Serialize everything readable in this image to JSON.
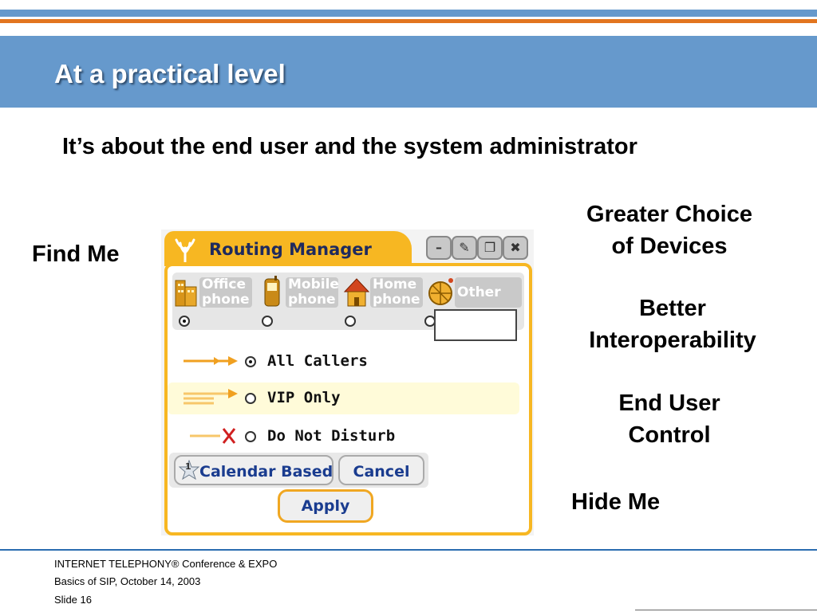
{
  "slide": {
    "title": "At a practical level",
    "subtitle": "It’s about the end user and the system administrator",
    "find_me": "Find Me",
    "hide_me": "Hide Me",
    "benefits": [
      {
        "line1": "Greater Choice",
        "line2": "of Devices"
      },
      {
        "line1": "Better",
        "line2": "Interoperability"
      },
      {
        "line1": "End User",
        "line2": "Control"
      }
    ]
  },
  "routing_manager": {
    "title": "Routing Manager",
    "window_controls": [
      "minimize-icon",
      "edit-icon",
      "restore-icon",
      "close-icon"
    ],
    "devices": [
      {
        "label1": "Office",
        "label2": "phone",
        "icon": "office-building-icon",
        "selected": true
      },
      {
        "label1": "Mobile",
        "label2": "phone",
        "icon": "mobile-phone-icon",
        "selected": false
      },
      {
        "label1": "Home",
        "label2": "phone",
        "icon": "house-icon",
        "selected": false
      },
      {
        "label1": "Other",
        "label2": "",
        "icon": "satellite-dish-icon",
        "selected": false
      }
    ],
    "other_value": "",
    "caller_options": [
      {
        "label": "All Callers",
        "selected": true,
        "icon": "forward-arrow-icon"
      },
      {
        "label": "VIP Only",
        "selected": false,
        "icon": "filtered-arrow-icon"
      },
      {
        "label": "Do Not Disturb",
        "selected": false,
        "icon": "blocked-arrow-icon"
      }
    ],
    "calendar_button": "Calendar Based",
    "calendar_badge": "1",
    "cancel_button": "Cancel",
    "apply_button": "Apply"
  },
  "footer": {
    "line1": "INTERNET TELEPHONY® Conference & EXPO",
    "line2": "Basics of SIP, October 14, 2003",
    "line3": "Slide 16"
  },
  "colors": {
    "accent_blue": "#6699cc",
    "accent_orange": "#e2751f",
    "widget_yellow": "#f7b722",
    "button_text": "#1a3c8f"
  }
}
